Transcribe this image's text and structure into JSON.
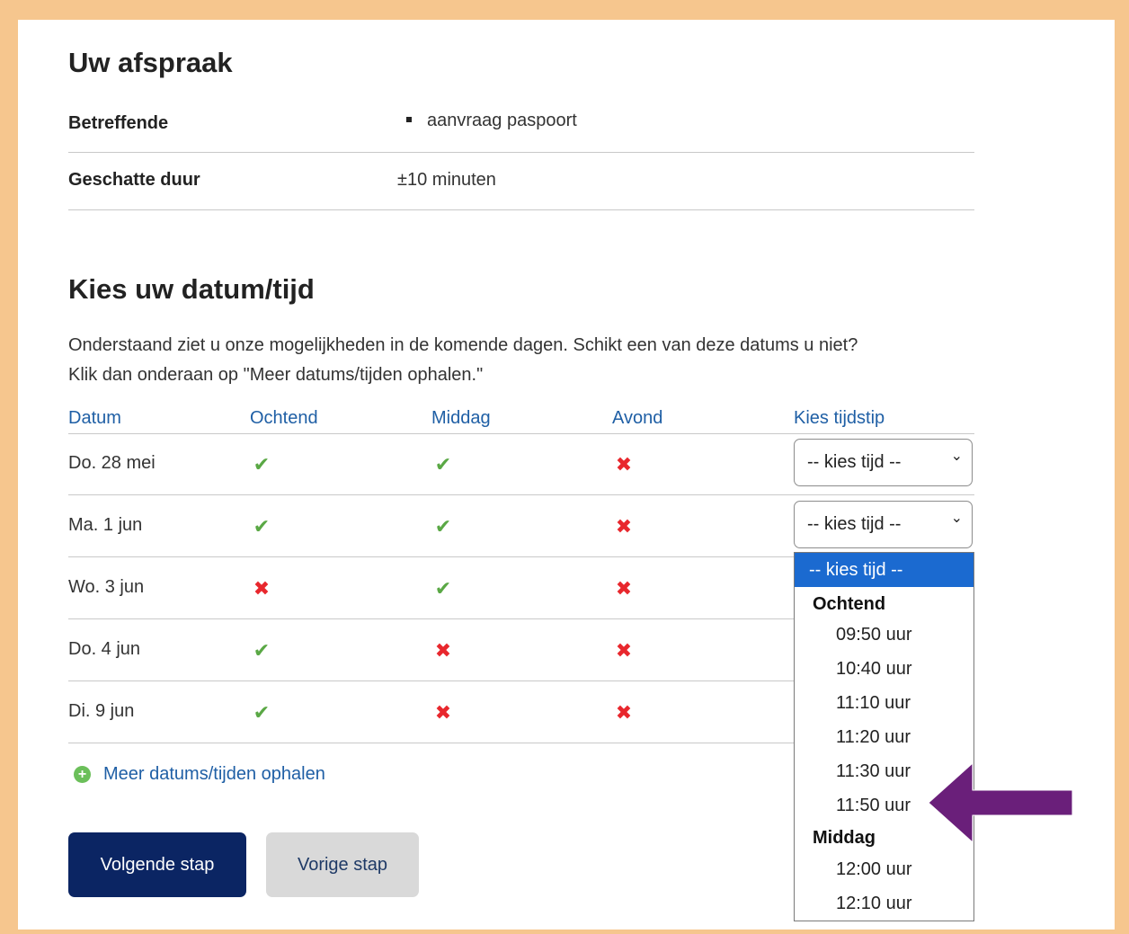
{
  "appointment": {
    "heading": "Uw afspraak",
    "subject_label": "Betreffende",
    "subject_value": "aanvraag paspoort",
    "duration_label": "Geschatte duur",
    "duration_value": "±10 minuten"
  },
  "choose": {
    "heading": "Kies uw datum/tijd",
    "intro_line1": "Onderstaand ziet u onze mogelijkheden in de komende dagen. Schikt een van deze datums u niet?",
    "intro_line2": "Klik dan onderaan op \"Meer datums/tijden ophalen.\""
  },
  "table": {
    "headers": [
      "Datum",
      "Ochtend",
      "Middag",
      "Avond",
      "Kies tijdstip"
    ],
    "rows": [
      {
        "date": "Do. 28 mei",
        "ochtend": "check-icon",
        "middag": "check-icon",
        "avond": "cross-icon"
      },
      {
        "date": "Ma. 1 jun",
        "ochtend": "check-icon",
        "middag": "check-icon",
        "avond": "cross-icon"
      },
      {
        "date": "Wo. 3 jun",
        "ochtend": "cross-icon",
        "middag": "check-icon",
        "avond": "cross-icon"
      },
      {
        "date": "Do. 4 jun",
        "ochtend": "check-icon",
        "middag": "cross-icon",
        "avond": "cross-icon"
      },
      {
        "date": "Di. 9 jun",
        "ochtend": "check-icon",
        "middag": "cross-icon",
        "avond": "cross-icon"
      }
    ],
    "select_placeholder": "-- kies tijd --"
  },
  "dropdown": {
    "selected": "-- kies tijd --",
    "group_morning": "Ochtend",
    "morning": [
      "09:50 uur",
      "10:40 uur",
      "11:10 uur",
      "11:20 uur",
      "11:30 uur",
      "11:50 uur"
    ],
    "group_afternoon": "Middag",
    "afternoon": [
      "12:00 uur",
      "12:10 uur"
    ]
  },
  "actions": {
    "more_link": "Meer datums/tijden ophalen",
    "next": "Volgende stap",
    "previous": "Vorige stap"
  },
  "colors": {
    "accent_blue": "#1f5fa5",
    "check_green": "#5aa845",
    "cross_red": "#e8272d",
    "primary_button": "#0b2563",
    "annotation_arrow": "#6a1f7a",
    "frame": "#f6c68e"
  }
}
